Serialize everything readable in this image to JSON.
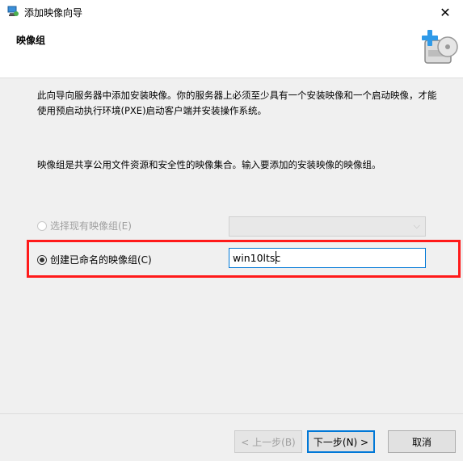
{
  "window": {
    "title": "添加映像向导",
    "close_glyph": "✕"
  },
  "header": {
    "title": "映像组"
  },
  "body": {
    "intro_text": "此向导向服务器中添加安装映像。你的服务器上必须至少具有一个安装映像和一个启动映像，才能使用预启动执行环境(PXE)启动客户端并安装操作系统。",
    "description_text": "映像组是共享公用文件资源和安全性的映像集合。输入要添加的安装映像的映像组。"
  },
  "options": {
    "existing_group": {
      "label": "选择现有映像组(E)",
      "enabled": false,
      "selected": false,
      "value": ""
    },
    "new_group": {
      "label": "创建已命名的映像组(C)",
      "enabled": true,
      "selected": true,
      "value": "win10ltsc"
    }
  },
  "footer": {
    "back_label": "< 上一步(B)",
    "next_label": "下一步(N) >",
    "cancel_label": "取消"
  },
  "colors": {
    "highlight": "#ff1a1a",
    "focus": "#0078d7",
    "disabled_text": "#a0a0a0"
  },
  "icons": {
    "app": "server-icon",
    "header_graphic": "add-image-icon",
    "combo_arrow": "chevron-down-icon",
    "close": "close-icon"
  }
}
